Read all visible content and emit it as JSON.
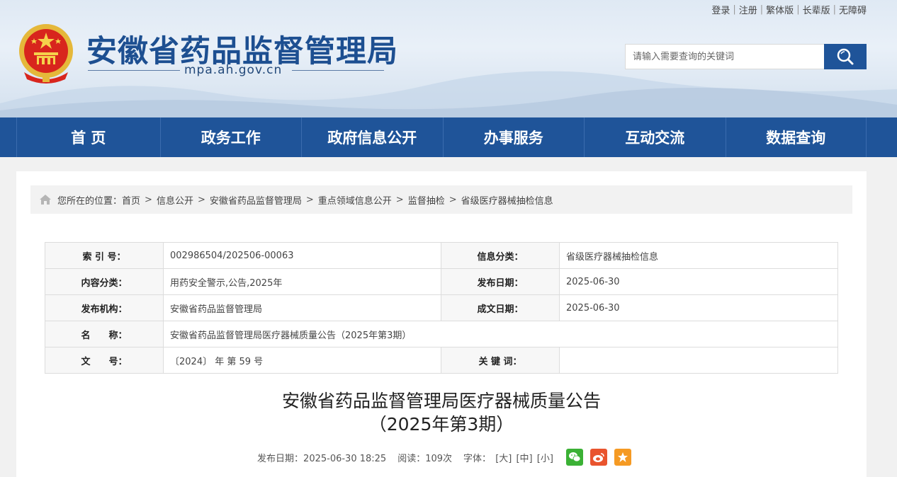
{
  "top_links": [
    "登录",
    "注册",
    "繁体版",
    "长辈版",
    "无障碍"
  ],
  "site": {
    "title": "安徽省药品监督管理局",
    "domain": "mpa.ah.gov.cn"
  },
  "search": {
    "placeholder": "请输入需要查询的关键词"
  },
  "nav": [
    "首 页",
    "政务工作",
    "政府信息公开",
    "办事服务",
    "互动交流",
    "数据查询"
  ],
  "breadcrumb": {
    "prefix": "您所在的位置：",
    "items": [
      "首页",
      "信息公开",
      "安徽省药品监督管理局",
      "重点领域信息公开",
      "监督抽检",
      "省级医疗器械抽检信息"
    ]
  },
  "meta": {
    "index_label": "索 引 号：",
    "index_value": "002986504/202506-00063",
    "category_label": "信息分类：",
    "category_value": "省级医疗器械抽检信息",
    "content_label": "内容分类：",
    "content_value": "用药安全警示,公告,2025年",
    "pub_date_label": "发布日期：",
    "pub_date_value": "2025-06-30",
    "org_label": "发布机构：",
    "org_value": "安徽省药品监督管理局",
    "doc_date_label": "成文日期：",
    "doc_date_value": "2025-06-30",
    "name_label": "名　　称：",
    "name_value": "安徽省药品监督管理局医疗器械质量公告（2025年第3期）",
    "doc_no_label": "文　　号：",
    "doc_no_value": "〔2024〕 年 第 59 号",
    "keywords_label": "关 键 词：",
    "keywords_value": ""
  },
  "article": {
    "title_line1": "安徽省药品监督管理局医疗器械质量公告",
    "title_line2": "（2025年第3期）",
    "pub_info": "发布日期：2025-06-30 18:25",
    "reads": "阅读：109次",
    "font_label": "字体：",
    "font_large": "[大]",
    "font_medium": "[中]",
    "font_small": "[小]"
  },
  "colors": {
    "nav_bg": "#1f5499",
    "title": "#1d4f91",
    "wechat": "#3bb135",
    "weibo": "#e9542e",
    "favorite": "#f59a23"
  }
}
